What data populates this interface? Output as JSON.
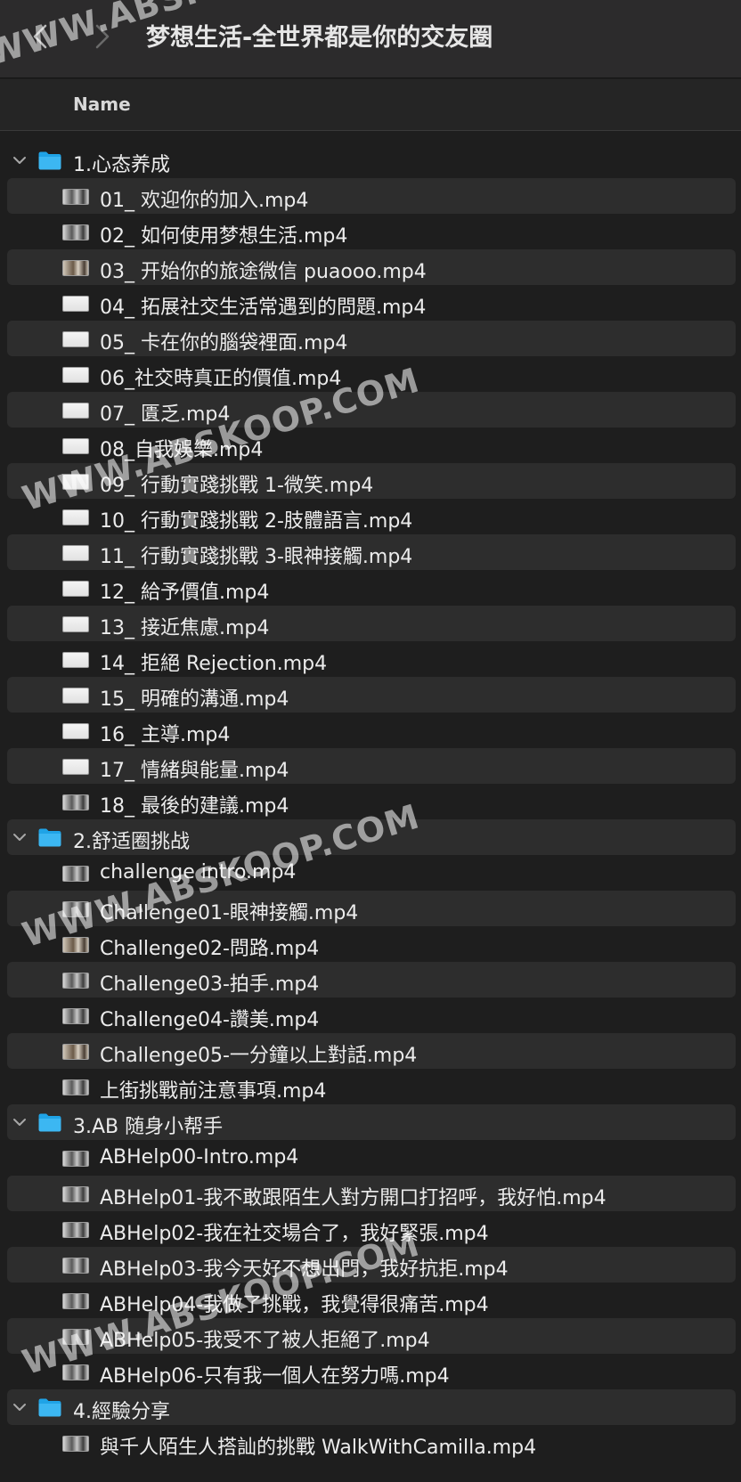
{
  "window": {
    "title": "梦想生活-全世界都是你的交友圈"
  },
  "column_header": {
    "name_label": "Name"
  },
  "watermark": "WWW.ABSKOOP.COM",
  "folders": [
    {
      "name": "1.心态养成",
      "files": [
        {
          "name": "01_ 欢迎你的加入.mp4",
          "thumb": "photo"
        },
        {
          "name": "02_ 如何使用梦想生活.mp4",
          "thumb": "photo"
        },
        {
          "name": "03_ 开始你的旅途微信 puaooo.mp4",
          "thumb": "warm"
        },
        {
          "name": "04_ 拓展社交生活常遇到的問題.mp4",
          "thumb": "light"
        },
        {
          "name": "05_ 卡在你的腦袋裡面.mp4",
          "thumb": "light"
        },
        {
          "name": "06_社交時真正的價值.mp4",
          "thumb": "light"
        },
        {
          "name": "07_ 匱乏.mp4",
          "thumb": "light"
        },
        {
          "name": "08_自我娛樂.mp4",
          "thumb": "light"
        },
        {
          "name": "09_ 行動實踐挑戰 1-微笑.mp4",
          "thumb": "light"
        },
        {
          "name": "10_ 行動實踐挑戰 2-肢體語言.mp4",
          "thumb": "light"
        },
        {
          "name": "11_ 行動實踐挑戰 3-眼神接觸.mp4",
          "thumb": "light"
        },
        {
          "name": "12_ 給予價值.mp4",
          "thumb": "light"
        },
        {
          "name": "13_ 接近焦慮.mp4",
          "thumb": "light"
        },
        {
          "name": "14_ 拒絕 Rejection.mp4",
          "thumb": "light"
        },
        {
          "name": "15_ 明確的溝通.mp4",
          "thumb": "light"
        },
        {
          "name": "16_ 主導.mp4",
          "thumb": "light"
        },
        {
          "name": "17_ 情緒與能量.mp4",
          "thumb": "light"
        },
        {
          "name": "18_ 最後的建議.mp4",
          "thumb": "photo"
        }
      ]
    },
    {
      "name": "2.舒适圈挑战",
      "files": [
        {
          "name": "challenge intro.mp4",
          "thumb": "photo"
        },
        {
          "name": "Challenge01-眼神接觸.mp4",
          "thumb": "photo"
        },
        {
          "name": "Challenge02-問路.mp4",
          "thumb": "warm"
        },
        {
          "name": "Challenge03-拍手.mp4",
          "thumb": "photo"
        },
        {
          "name": "Challenge04-讚美.mp4",
          "thumb": "photo"
        },
        {
          "name": "Challenge05-一分鐘以上對話.mp4",
          "thumb": "warm"
        },
        {
          "name": "上街挑戰前注意事項.mp4",
          "thumb": "photo"
        }
      ]
    },
    {
      "name": "3.AB 随身小帮手",
      "files": [
        {
          "name": "ABHelp00-Intro.mp4",
          "thumb": "photo"
        },
        {
          "name": "ABHelp01-我不敢跟陌生人對方開口打招呼，我好怕.mp4",
          "thumb": "photo"
        },
        {
          "name": "ABHelp02-我在社交場合了，我好緊張.mp4",
          "thumb": "photo"
        },
        {
          "name": "ABHelp03-我今天好不想出門，我好抗拒.mp4",
          "thumb": "photo"
        },
        {
          "name": "ABHelp04-我做了挑戰，我覺得很痛苦.mp4",
          "thumb": "photo"
        },
        {
          "name": "ABHelp05-我受不了被人拒絕了.mp4",
          "thumb": "photo"
        },
        {
          "name": "ABHelp06-只有我一個人在努力嗎.mp4",
          "thumb": "photo"
        }
      ]
    },
    {
      "name": "4.經驗分享",
      "files": [
        {
          "name": "與千人陌生人搭訕的挑戰 WalkWithCamilla.mp4",
          "thumb": "photo"
        }
      ]
    }
  ]
}
